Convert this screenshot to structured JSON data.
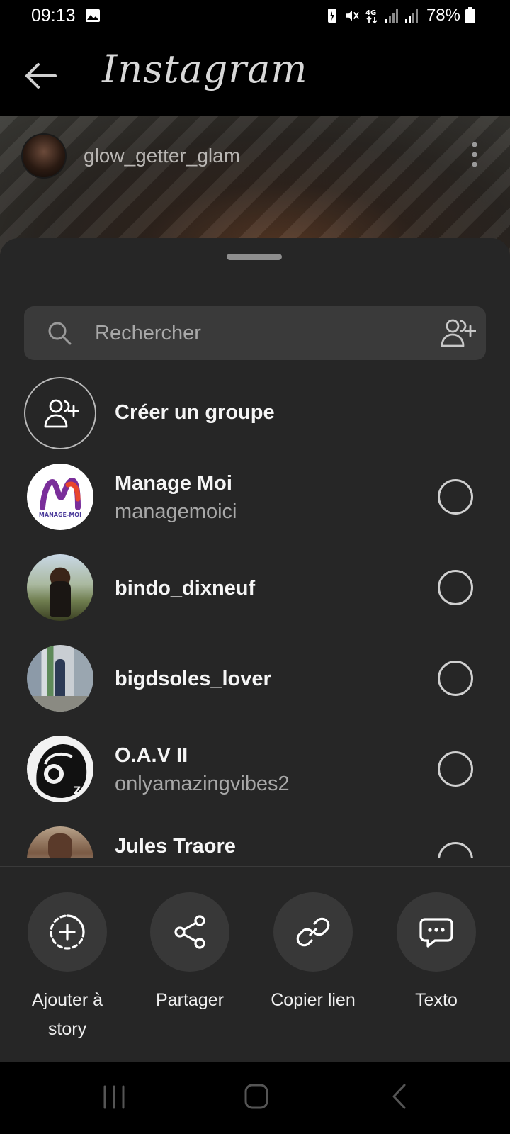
{
  "status_bar": {
    "time": "09:13",
    "battery": "78%",
    "icons": [
      "image-icon",
      "battery-saver-icon",
      "mute-icon",
      "4g-icon",
      "signal-icon",
      "signal-icon",
      "battery-icon"
    ]
  },
  "header": {
    "app_name": "Instagram",
    "back_icon": "arrow-left-icon"
  },
  "post": {
    "username": "glow_getter_glam",
    "menu_icon": "more-vertical-icon"
  },
  "sheet": {
    "search": {
      "placeholder": "Rechercher",
      "value": ""
    },
    "create_group": {
      "label": "Créer un groupe"
    },
    "contacts": [
      {
        "name": "Manage Moi",
        "username": "managemoici",
        "selected": false
      },
      {
        "name": "bindo_dixneuf",
        "username": "",
        "selected": false
      },
      {
        "name": "bigdsoles_lover",
        "username": "",
        "selected": false
      },
      {
        "name": "O.A.V II",
        "username": "onlyamazingvibes2",
        "selected": false
      },
      {
        "name": "Jules Traore",
        "username": "",
        "selected": false
      }
    ],
    "logo_text": "MANAGE-MOI",
    "actions": [
      {
        "label": "Ajouter à story",
        "icon": "add-to-story-icon"
      },
      {
        "label": "Partager",
        "icon": "share-icon"
      },
      {
        "label": "Copier lien",
        "icon": "link-icon"
      },
      {
        "label": "Texto",
        "icon": "message-icon"
      }
    ]
  },
  "colors": {
    "sheet_bg": "#262626",
    "search_bg": "#3a3a3a",
    "action_circle_bg": "#383838",
    "text_primary": "#f5f5f5",
    "text_secondary": "#a8a8a8"
  }
}
